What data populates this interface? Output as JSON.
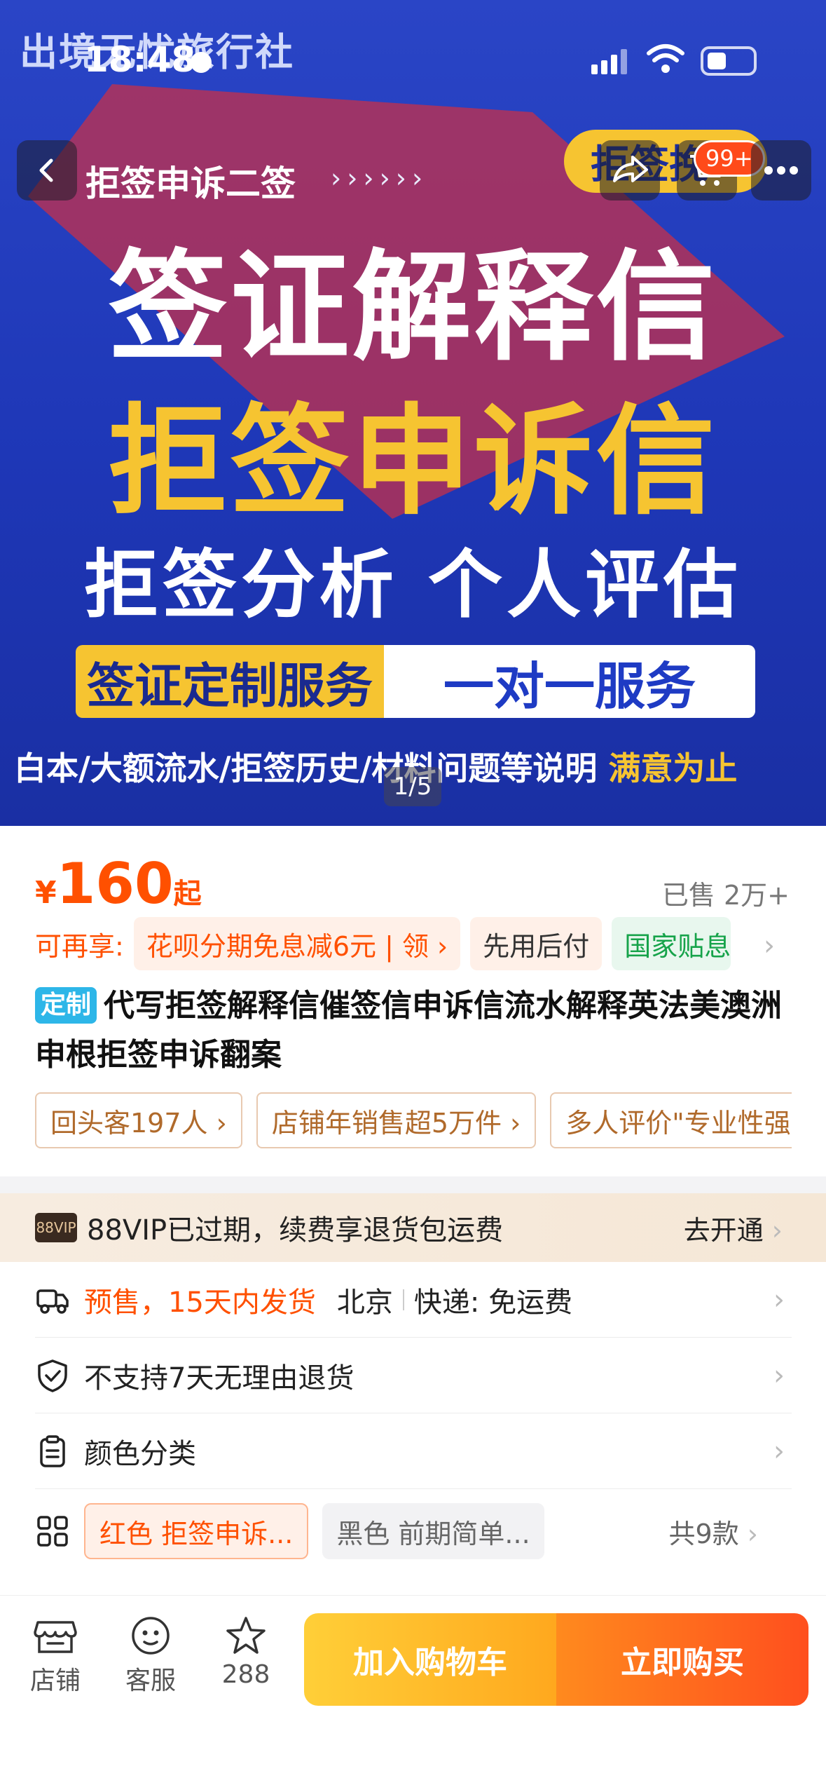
{
  "status_bar": {
    "time": "18:48"
  },
  "hero": {
    "brand": "出境无忧旅行社",
    "subtitle": "拒签申诉二签",
    "arrows": "››››››",
    "pill": "拒签挽",
    "headline1": "签证解释信",
    "headline2": "拒签申诉信",
    "headline3": "拒签分析 个人评估",
    "banner_left": "签证定制服务",
    "banner_right": "一对一服务",
    "note": "白本/大额流水/拒签历史/材料问题等说明",
    "note_highlight": "满意为止",
    "counter": "1/5",
    "cart_badge": "99+"
  },
  "product": {
    "price_currency": "¥",
    "price": "160",
    "price_suffix": "起",
    "sold": "已售 2万+",
    "perks_label": "可再享:",
    "perk1": "花呗分期免息减6元 | 领 ›",
    "perk2": "先用后付",
    "perk3": "国家贴息",
    "tag": "定制",
    "title": "代写拒签解释信催签信申诉信流水解释英法美澳洲申根拒签申诉翻案",
    "badges": [
      "回头客197人 ›",
      "店铺年销售超5万件 ›",
      "多人评价\"专业性强"
    ]
  },
  "vip": {
    "logo": "88VIP",
    "text": "88VIP已过期，续费享退货包运费",
    "action": "去开通"
  },
  "rows": {
    "ship_presale": "预售，15天内发货",
    "ship_city": "北京",
    "ship_fee": "快递: 免运费",
    "returns": "不支持7天无理由退货",
    "variants_title": "颜色分类",
    "sku1": "红色 拒签申诉...",
    "sku2": "黑色 前期简单...",
    "sku_count": "共9款"
  },
  "bottom_bar": {
    "shop": "店铺",
    "service": "客服",
    "favorites": "288",
    "add_to_cart": "加入购物车",
    "buy_now": "立即购买"
  },
  "colors": {
    "accent": "#ff5000",
    "hero_blue": "#1e37b7",
    "hero_yellow": "#f6c431"
  }
}
